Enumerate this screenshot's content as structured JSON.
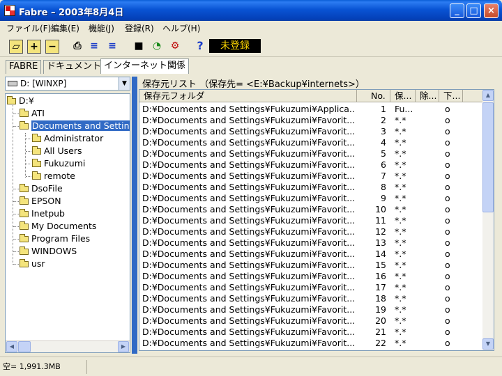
{
  "window": {
    "title": "Fabre  – 2003年8月4日"
  },
  "menu": [
    "ファイル(F)",
    "編集(E)",
    "機能(J)",
    "登録(R)",
    "ヘルプ(H)"
  ],
  "toolbar": {
    "buttons": [
      {
        "name": "open-folder-icon",
        "glyph": "▱"
      },
      {
        "name": "add-icon",
        "glyph": "+"
      },
      {
        "name": "remove-icon",
        "glyph": "−"
      },
      {
        "name": "printer-icon",
        "glyph": "⎙"
      },
      {
        "name": "expand-icon",
        "glyph": "≡"
      },
      {
        "name": "collapse-icon",
        "glyph": "≡"
      },
      {
        "name": "save-icon",
        "glyph": "■"
      },
      {
        "name": "schedule-icon",
        "glyph": "◔"
      },
      {
        "name": "tools-icon",
        "glyph": "⚙"
      },
      {
        "name": "help-icon",
        "glyph": "?"
      }
    ],
    "status_badge": "未登録"
  },
  "tabs": [
    {
      "label": "FABRE",
      "active": false
    },
    {
      "label": "ドキュメント",
      "active": false
    },
    {
      "label": "インターネット関係",
      "active": true
    }
  ],
  "drive_select": {
    "value": "D: [WINXP]"
  },
  "tree": {
    "root": "D:¥",
    "items": [
      {
        "label": "ATI",
        "level": 1
      },
      {
        "label": "Documents and Settings",
        "level": 1,
        "selected": true,
        "open": true
      },
      {
        "label": "Administrator",
        "level": 2
      },
      {
        "label": "All Users",
        "level": 2
      },
      {
        "label": "Fukuzumi",
        "level": 2
      },
      {
        "label": "remote",
        "level": 2
      },
      {
        "label": "DsoFile",
        "level": 1
      },
      {
        "label": "EPSON",
        "level": 1
      },
      {
        "label": "Inetpub",
        "level": 1
      },
      {
        "label": "My Documents",
        "level": 1
      },
      {
        "label": "Program Files",
        "level": 1
      },
      {
        "label": "WINDOWS",
        "level": 1
      },
      {
        "label": "usr",
        "level": 1
      }
    ]
  },
  "list": {
    "caption": "保存元リスト （保存先= <E:¥Backup¥internets>）",
    "columns": [
      "保存元フォルダ",
      "No.",
      "保...",
      "除...",
      "下..."
    ],
    "rows": [
      {
        "folder": "D:¥Documents and Settings¥Fukuzumi¥Applica...",
        "no": "1",
        "pattern": "Fu...",
        "exclude": "",
        "sub": "o"
      },
      {
        "folder": "D:¥Documents and Settings¥Fukuzumi¥Favorit...",
        "no": "2",
        "pattern": "*.*",
        "exclude": "",
        "sub": "o"
      },
      {
        "folder": "D:¥Documents and Settings¥Fukuzumi¥Favorit...",
        "no": "3",
        "pattern": "*.*",
        "exclude": "",
        "sub": "o"
      },
      {
        "folder": "D:¥Documents and Settings¥Fukuzumi¥Favorit...",
        "no": "4",
        "pattern": "*.*",
        "exclude": "",
        "sub": "o"
      },
      {
        "folder": "D:¥Documents and Settings¥Fukuzumi¥Favorit...",
        "no": "5",
        "pattern": "*.*",
        "exclude": "",
        "sub": "o"
      },
      {
        "folder": "D:¥Documents and Settings¥Fukuzumi¥Favorit...",
        "no": "6",
        "pattern": "*.*",
        "exclude": "",
        "sub": "o"
      },
      {
        "folder": "D:¥Documents and Settings¥Fukuzumi¥Favorit...",
        "no": "7",
        "pattern": "*.*",
        "exclude": "",
        "sub": "o"
      },
      {
        "folder": "D:¥Documents and Settings¥Fukuzumi¥Favorit...",
        "no": "8",
        "pattern": "*.*",
        "exclude": "",
        "sub": "o"
      },
      {
        "folder": "D:¥Documents and Settings¥Fukuzumi¥Favorit...",
        "no": "9",
        "pattern": "*.*",
        "exclude": "",
        "sub": "o"
      },
      {
        "folder": "D:¥Documents and Settings¥Fukuzumi¥Favorit...",
        "no": "10",
        "pattern": "*.*",
        "exclude": "",
        "sub": "o"
      },
      {
        "folder": "D:¥Documents and Settings¥Fukuzumi¥Favorit...",
        "no": "11",
        "pattern": "*.*",
        "exclude": "",
        "sub": "o"
      },
      {
        "folder": "D:¥Documents and Settings¥Fukuzumi¥Favorit...",
        "no": "12",
        "pattern": "*.*",
        "exclude": "",
        "sub": "o"
      },
      {
        "folder": "D:¥Documents and Settings¥Fukuzumi¥Favorit...",
        "no": "13",
        "pattern": "*.*",
        "exclude": "",
        "sub": "o"
      },
      {
        "folder": "D:¥Documents and Settings¥Fukuzumi¥Favorit...",
        "no": "14",
        "pattern": "*.*",
        "exclude": "",
        "sub": "o"
      },
      {
        "folder": "D:¥Documents and Settings¥Fukuzumi¥Favorit...",
        "no": "15",
        "pattern": "*.*",
        "exclude": "",
        "sub": "o"
      },
      {
        "folder": "D:¥Documents and Settings¥Fukuzumi¥Favorit...",
        "no": "16",
        "pattern": "*.*",
        "exclude": "",
        "sub": "o"
      },
      {
        "folder": "D:¥Documents and Settings¥Fukuzumi¥Favorit...",
        "no": "17",
        "pattern": "*.*",
        "exclude": "",
        "sub": "o"
      },
      {
        "folder": "D:¥Documents and Settings¥Fukuzumi¥Favorit...",
        "no": "18",
        "pattern": "*.*",
        "exclude": "",
        "sub": "o"
      },
      {
        "folder": "D:¥Documents and Settings¥Fukuzumi¥Favorit...",
        "no": "19",
        "pattern": "*.*",
        "exclude": "",
        "sub": "o"
      },
      {
        "folder": "D:¥Documents and Settings¥Fukuzumi¥Favorit...",
        "no": "20",
        "pattern": "*.*",
        "exclude": "",
        "sub": "o"
      },
      {
        "folder": "D:¥Documents and Settings¥Fukuzumi¥Favorit...",
        "no": "21",
        "pattern": "*.*",
        "exclude": "",
        "sub": "o"
      },
      {
        "folder": "D:¥Documents and Settings¥Fukuzumi¥Favorit...",
        "no": "22",
        "pattern": "*.*",
        "exclude": "",
        "sub": "o"
      }
    ]
  },
  "statusbar": {
    "free_space": "空= 1,991.3MB"
  }
}
